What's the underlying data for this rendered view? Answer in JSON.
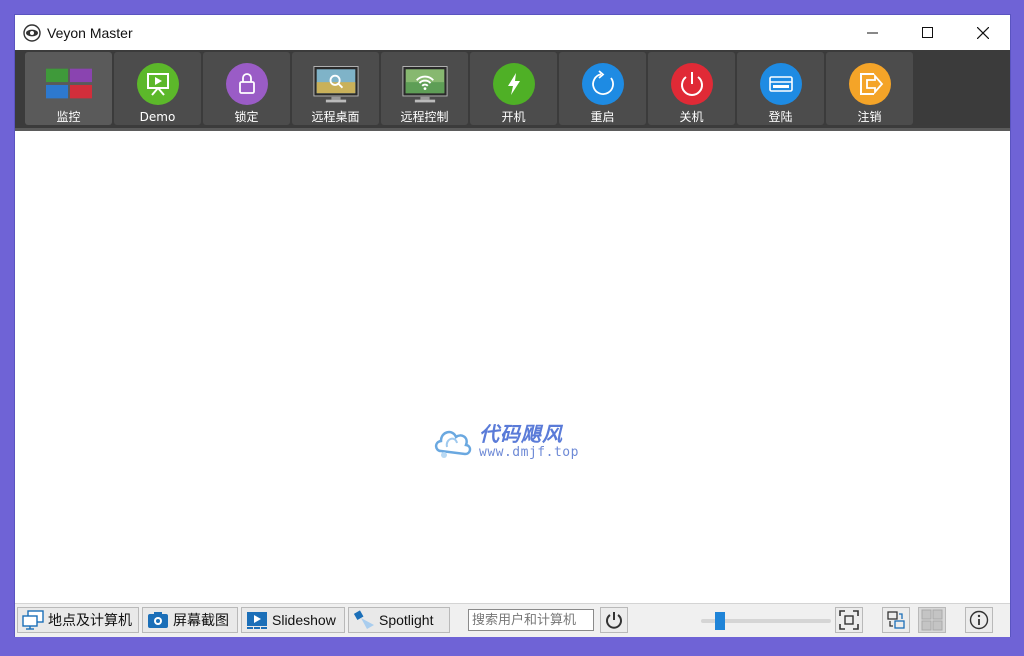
{
  "window": {
    "title": "Veyon Master",
    "controls": [
      "minimize",
      "maximize",
      "close"
    ]
  },
  "toolbar": {
    "buttons": [
      {
        "label": "监控",
        "icon": "monitor-grid-icon",
        "active": true
      },
      {
        "label": "Demo",
        "icon": "presentation-icon",
        "color": "#5cb82a"
      },
      {
        "label": "锁定",
        "icon": "lock-icon",
        "color": "#9a5cc6"
      },
      {
        "label": "远程桌面",
        "icon": "remote-view-icon"
      },
      {
        "label": "远程控制",
        "icon": "remote-control-icon"
      },
      {
        "label": "开机",
        "icon": "power-on-icon",
        "color": "#4fb026"
      },
      {
        "label": "重启",
        "icon": "reboot-icon",
        "color": "#1e8be3"
      },
      {
        "label": "关机",
        "icon": "shutdown-icon",
        "color": "#e02a36"
      },
      {
        "label": "登陆",
        "icon": "logon-icon",
        "color": "#1e8be3"
      },
      {
        "label": "注销",
        "icon": "logoff-icon",
        "color": "#f4a428"
      }
    ]
  },
  "watermark": {
    "title": "代码飓风",
    "url": "www.dmjf.top"
  },
  "statusbar": {
    "locations_label": "地点及计算机",
    "screenshots_label": "屏幕截图",
    "slideshow_label": "Slideshow",
    "spotlight_label": "Spotlight",
    "search_placeholder": "搜索用户和计算机",
    "zoom_level": 0.1
  }
}
